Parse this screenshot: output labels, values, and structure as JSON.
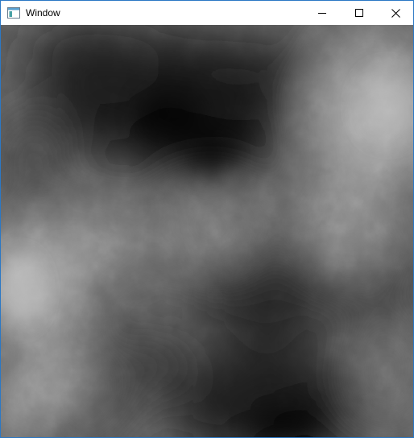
{
  "window": {
    "title": "Window",
    "icon": "window-app-icon",
    "controls": {
      "minimize_icon": "minimize-icon",
      "maximize_icon": "maximize-icon",
      "close_icon": "close-icon"
    },
    "accent_color": "#2b78c5"
  },
  "content": {
    "image": "grayscale-noise-heightmap"
  }
}
